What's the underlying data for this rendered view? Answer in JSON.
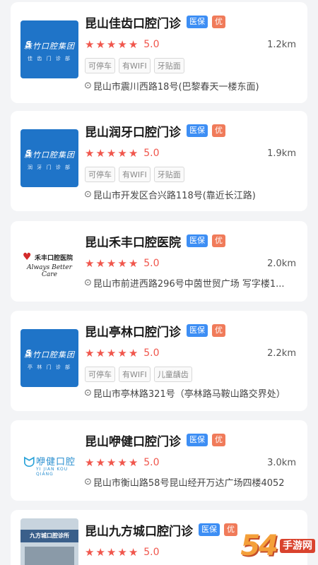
{
  "clinics": [
    {
      "name": "昆山佳齿口腔门诊",
      "tag_insurance": "医保",
      "tag_premium": "优",
      "score": "5.0",
      "distance": "1.2km",
      "features": [
        "可停车",
        "有WIFI",
        "牙贴面"
      ],
      "address": "昆山市震川西路18号(巴黎春天一楼东面)",
      "logo": {
        "line1": "森竹口腔集团",
        "line2": "佳 齿 门 诊 部"
      }
    },
    {
      "name": "昆山润牙口腔门诊",
      "tag_insurance": "医保",
      "tag_premium": "优",
      "score": "5.0",
      "distance": "1.9km",
      "features": [
        "可停车",
        "有WIFI",
        "牙贴面"
      ],
      "address": "昆山市开发区合兴路118号(靠近长江路)",
      "logo": {
        "line1": "森竹口腔集团",
        "line2": "润 牙 门 诊 部"
      }
    },
    {
      "name": "昆山禾丰口腔医院",
      "tag_insurance": "医保",
      "tag_premium": "优",
      "score": "5.0",
      "distance": "2.0km",
      "features": [],
      "address": "昆山市前进西路296号中茵世贸广场 写字楼1...",
      "logo": {
        "line1": "禾丰口腔医院",
        "line2": "Always Better Care"
      }
    },
    {
      "name": "昆山亭林口腔门诊",
      "tag_insurance": "医保",
      "tag_premium": "优",
      "score": "5.0",
      "distance": "2.2km",
      "features": [
        "可停车",
        "有WIFI",
        "儿童龋齿"
      ],
      "address": "昆山市亭林路321号（亭林路马鞍山路交界处）",
      "logo": {
        "line1": "森竹口腔集团",
        "line2": "亭 林 门 诊 部"
      }
    },
    {
      "name": "昆山咿健口腔门诊",
      "tag_insurance": "医保",
      "tag_premium": "优",
      "score": "5.0",
      "distance": "3.0km",
      "features": [],
      "address": "昆山市衡山路58号昆山经开万达广场四楼4052",
      "logo": {
        "line1": "咿健口腔",
        "line2": "YI JIAN KOU QIANG"
      }
    },
    {
      "name": "昆山九方城口腔门诊",
      "tag_insurance": "医保",
      "tag_premium": "优",
      "score": "5.0",
      "distance": "",
      "features": [],
      "address": "",
      "logo": {
        "line1": "九方城口腔诊所",
        "line2": ""
      }
    }
  ],
  "watermark": {
    "number": "54",
    "text": "手游网"
  },
  "colors": {
    "accent": "#f0564c",
    "insurance": "#3d8ef4",
    "premium": "#f07b5a",
    "logo_blue": "#1f74c8"
  },
  "icons": {
    "star": "star-icon",
    "pin": "location-pin-icon"
  }
}
